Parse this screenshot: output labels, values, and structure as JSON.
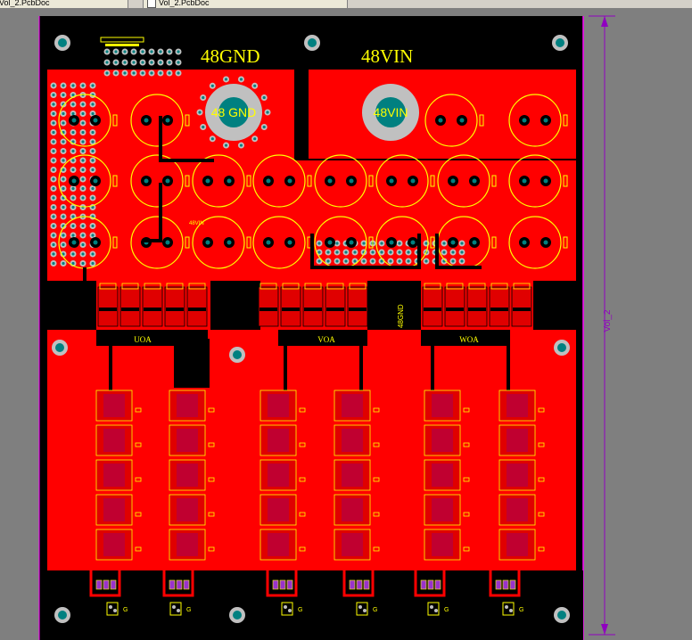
{
  "tabs": [
    {
      "label": "Vol_2.PcbDoc"
    },
    {
      "label": "Vol_2.PcbDoc"
    }
  ],
  "board": {
    "label_gnd": "48GND",
    "label_vin": "48VIN",
    "pad_gnd": "48 GND",
    "pad_vin": "48VIN",
    "center_net": "48GND",
    "silk_48vin": "48VIN",
    "phases": [
      "UOA",
      "VOA",
      "WOA"
    ],
    "gate_label": "G",
    "dimension_text": "Vol_2"
  },
  "colors": {
    "top_copper": "#ff0000",
    "silkscreen": "#ffff00",
    "board_bg": "#000000",
    "pad": "#c0c0c0",
    "via_hole": "#008080",
    "keepout": "#ff00ff",
    "workspace": "#7f7f7f"
  }
}
